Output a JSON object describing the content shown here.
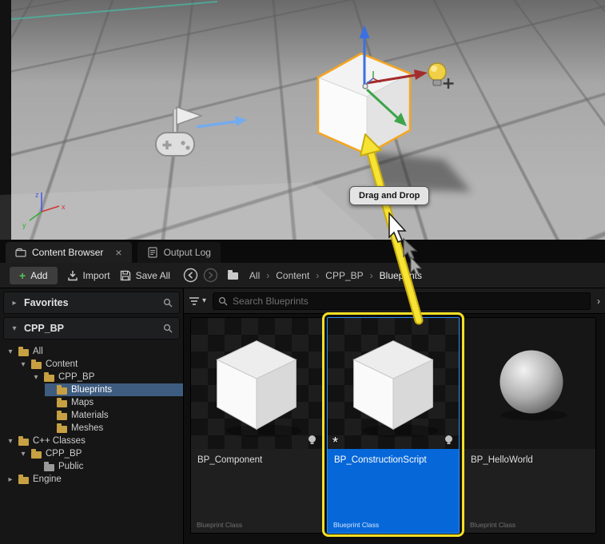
{
  "viewport": {
    "tooltip_label": "Drag and Drop",
    "axis": {
      "x": "x",
      "y": "y",
      "z": "z"
    }
  },
  "tab_bar": {
    "tabs": [
      {
        "label": "Content Browser"
      },
      {
        "label": "Output Log"
      }
    ]
  },
  "toolbar": {
    "plus_glyph": "+",
    "add_label": "Add",
    "import_label": "Import",
    "save_all_label": "Save All",
    "breadcrumbs": [
      "All",
      "Content",
      "CPP_BP",
      "Blueprints"
    ]
  },
  "sidebar": {
    "favorites_header": "Favorites",
    "collection_header": "CPP_BP",
    "tree": [
      {
        "label": "All"
      },
      {
        "label": "Content"
      },
      {
        "label": "CPP_BP"
      },
      {
        "label": "Blueprints",
        "selected": true
      },
      {
        "label": "Maps"
      },
      {
        "label": "Materials"
      },
      {
        "label": "Meshes"
      },
      {
        "label": "C++ Classes"
      },
      {
        "label": "CPP_BP"
      },
      {
        "label": "Public"
      },
      {
        "label": "Engine"
      }
    ]
  },
  "content": {
    "search_placeholder": "Search Blueprints",
    "assets": [
      {
        "name": "BP_Component",
        "type_label": "Blueprint Class",
        "thumb": "cube",
        "selected": false
      },
      {
        "name": "BP_ConstructionScript",
        "type_label": "Blueprint Class",
        "thumb": "cube",
        "selected": true,
        "dirty_marker": "*"
      },
      {
        "name": "BP_HelloWorld",
        "type_label": "Blueprint Class",
        "thumb": "sphere",
        "selected": false
      }
    ]
  },
  "icons": {
    "close": "×",
    "chevron_down": "▾",
    "chevron_right": "▸",
    "breadcrumb_separator": "›",
    "options_caret": "›"
  },
  "colors": {
    "selection_blue": "#0667d8",
    "annotation_yellow": "#f6df25",
    "tree_selected_blue": "#3e5c80",
    "add_green": "#51c556",
    "gizmo_orange": "#f6a51f"
  }
}
